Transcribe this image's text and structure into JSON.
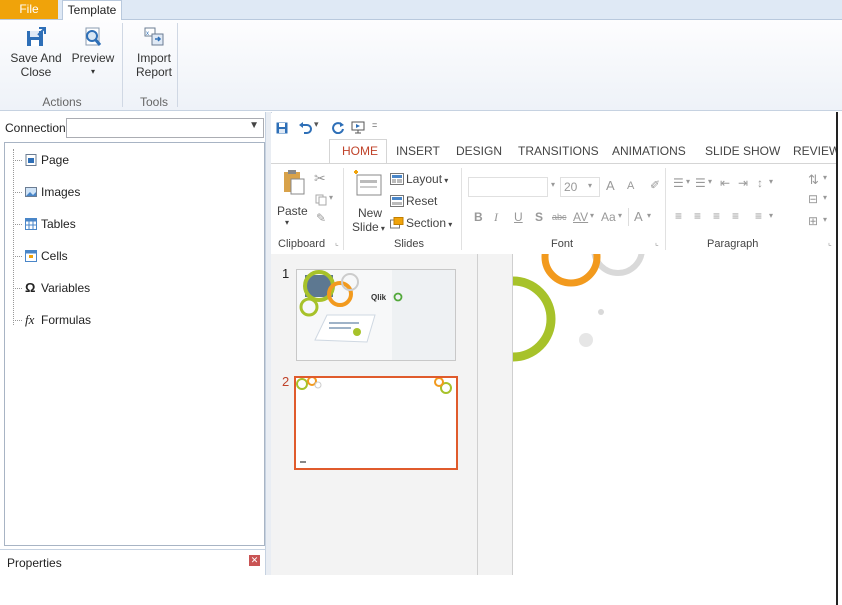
{
  "app_tabs": {
    "file": "File",
    "template": "Template"
  },
  "ribbon": {
    "buttons": [
      {
        "label_line1": "Save And",
        "label_line2": "Close",
        "icon": "save-close-icon"
      },
      {
        "label_line1": "Preview",
        "label_line2": "▾",
        "icon": "preview-magnifier-icon"
      },
      {
        "label_line1": "Import",
        "label_line2": "Report",
        "icon": "import-report-icon"
      }
    ],
    "groups": {
      "actions": "Actions",
      "tools": "Tools"
    }
  },
  "connection": {
    "label": "Connection",
    "value": ""
  },
  "tree": [
    {
      "label": "Page",
      "icon": "page-icon"
    },
    {
      "label": "Images",
      "icon": "images-icon"
    },
    {
      "label": "Tables",
      "icon": "tables-icon"
    },
    {
      "label": "Cells",
      "icon": "cells-icon"
    },
    {
      "label": "Variables",
      "icon": "omega-icon"
    },
    {
      "label": "Formulas",
      "icon": "fx-icon"
    }
  ],
  "properties": {
    "label": "Properties"
  },
  "powerpoint": {
    "tabs": [
      "HOME",
      "INSERT",
      "DESIGN",
      "TRANSITIONS",
      "ANIMATIONS",
      "SLIDE SHOW",
      "REVIEW"
    ],
    "clipboard": {
      "paste": "Paste",
      "group": "Clipboard"
    },
    "slides": {
      "new_line1": "New",
      "new_line2": "Slide",
      "layout": "Layout",
      "reset": "Reset",
      "section": "Section",
      "group": "Slides"
    },
    "font": {
      "size": "20",
      "group": "Font",
      "bold": "B",
      "italic": "I",
      "underline": "U",
      "shadow": "S",
      "strike": "abc",
      "spacing": "AV",
      "case": "Aa",
      "color": "A"
    },
    "paragraph": {
      "group": "Paragraph"
    },
    "slide_numbers": [
      "1",
      "2"
    ],
    "logo_text": "Qlik"
  },
  "colors": {
    "accent_orange": "#f0a30a",
    "slide_border": "#e05b2c",
    "ring_green": "#a7c22a",
    "ring_orange": "#f29a1e"
  }
}
